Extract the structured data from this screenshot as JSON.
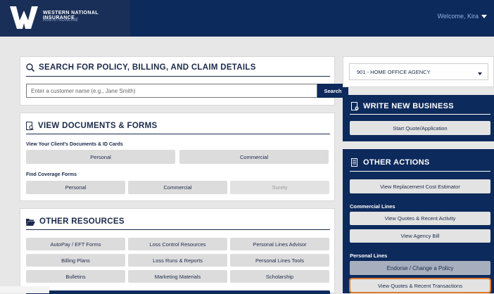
{
  "header": {
    "brand_line1": "Western National Insurance",
    "brand_line2": "AGENTSONLINE",
    "welcome": "Welcome, Kira"
  },
  "search": {
    "heading": "SEARCH FOR POLICY, BILLING, AND CLAIM DETAILS",
    "placeholder": "Enter a customer name (e.g., Jane Smith)",
    "button": "Search"
  },
  "documents": {
    "heading": "VIEW DOCUMENTS & FORMS",
    "client_label": "View Your Client's Documents & ID Cards",
    "client_buttons": [
      "Personal",
      "Commercial"
    ],
    "coverage_label": "Find Coverage Forms",
    "coverage_buttons": [
      "Personal",
      "Commercial",
      "Surety"
    ]
  },
  "resources": {
    "heading": "OTHER RESOURCES",
    "buttons": [
      "AutoPay / EFT Forms",
      "Loss Control Resources",
      "Personal Lines Advisor",
      "Billing Plans",
      "Loss Runs & Reports",
      "Personal Lines Tools",
      "Bulletins",
      "Marketing Materials",
      "Scholarship"
    ]
  },
  "agency_select": {
    "value": "901 - HOME OFFICE AGENCY"
  },
  "new_business": {
    "heading": "WRITE NEW BUSINESS",
    "button": "Start Quote/Application"
  },
  "other_actions": {
    "heading": "OTHER ACTIONS",
    "replacement": "View Replacement Cost Estimator",
    "commercial_label": "Commercial Lines",
    "commercial_buttons": [
      "View Quotes & Recent Activity",
      "View Agency Bill"
    ],
    "personal_label": "Personal Lines",
    "personal_buttons": [
      "Endorse / Change a Policy",
      "View Quotes & Recent Transactions"
    ]
  },
  "colors": {
    "navy": "#0d2a5c",
    "highlight": "#e07a2c"
  }
}
